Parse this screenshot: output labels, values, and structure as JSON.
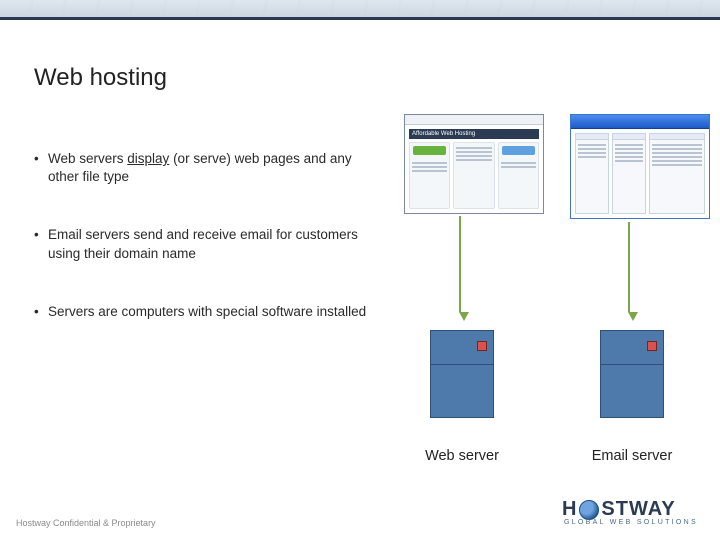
{
  "slide": {
    "title": "Web hosting",
    "bullets": [
      {
        "pre": "Web servers ",
        "u": "display",
        "post": " (or serve) web pages and any other file type"
      },
      {
        "text": "Email servers send and receive email for customers using their domain name"
      },
      {
        "text": "Servers are computers with special software installed"
      }
    ],
    "labels": {
      "web": "Web server",
      "email": "Email server"
    }
  },
  "footer": {
    "confidential": "Hostway Confidential & Proprietary"
  },
  "brand": {
    "name_left": "H",
    "name_right": "STWAY",
    "sub": "GLOBAL WEB SOLUTIONS"
  }
}
